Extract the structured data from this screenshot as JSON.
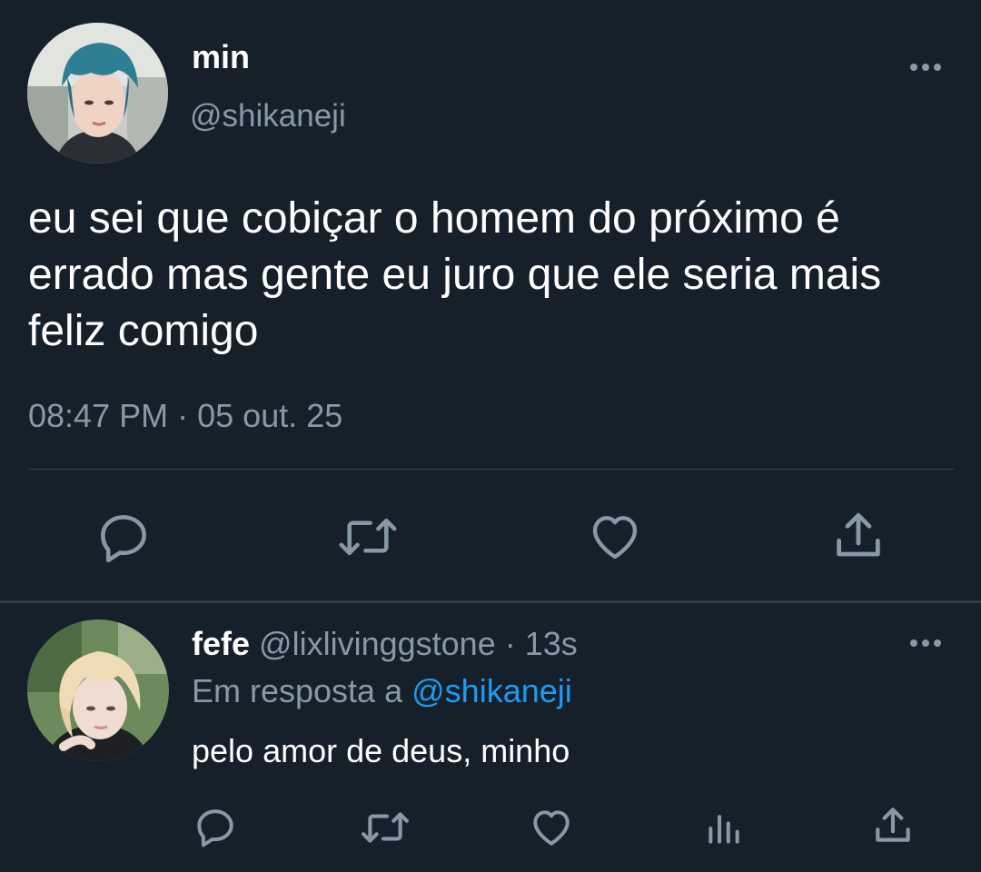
{
  "colors": {
    "background": "#15202b",
    "text_primary": "#ffffff",
    "text_secondary": "#8899a6",
    "link": "#1d9bf0",
    "divider": "#38444d"
  },
  "main_tweet": {
    "author_name": "min",
    "author_handle": "@shikaneji",
    "text": "eu sei que cobiçar o homem do próximo é errado mas gente eu juro que ele seria mais feliz comigo",
    "time": "08:47 PM",
    "separator": "·",
    "date": "05 out. 25",
    "avatar_icon": "profile-photo",
    "more_icon": "more-options-icon",
    "actions": {
      "reply_icon": "reply-icon",
      "retweet_icon": "retweet-icon",
      "like_icon": "like-icon",
      "share_icon": "share-icon"
    }
  },
  "reply_tweet": {
    "author_name": "fefe",
    "author_handle": "@lixlivinggstone",
    "separator": "·",
    "age": "13s",
    "reply_prefix": "Em resposta a",
    "reply_mention": "@shikaneji",
    "text": "pelo amor de deus, minho",
    "avatar_icon": "profile-photo",
    "more_icon": "more-options-icon",
    "actions": {
      "reply_icon": "reply-icon",
      "retweet_icon": "retweet-icon",
      "like_icon": "like-icon",
      "stats_icon": "views-icon",
      "share_icon": "share-icon"
    }
  }
}
